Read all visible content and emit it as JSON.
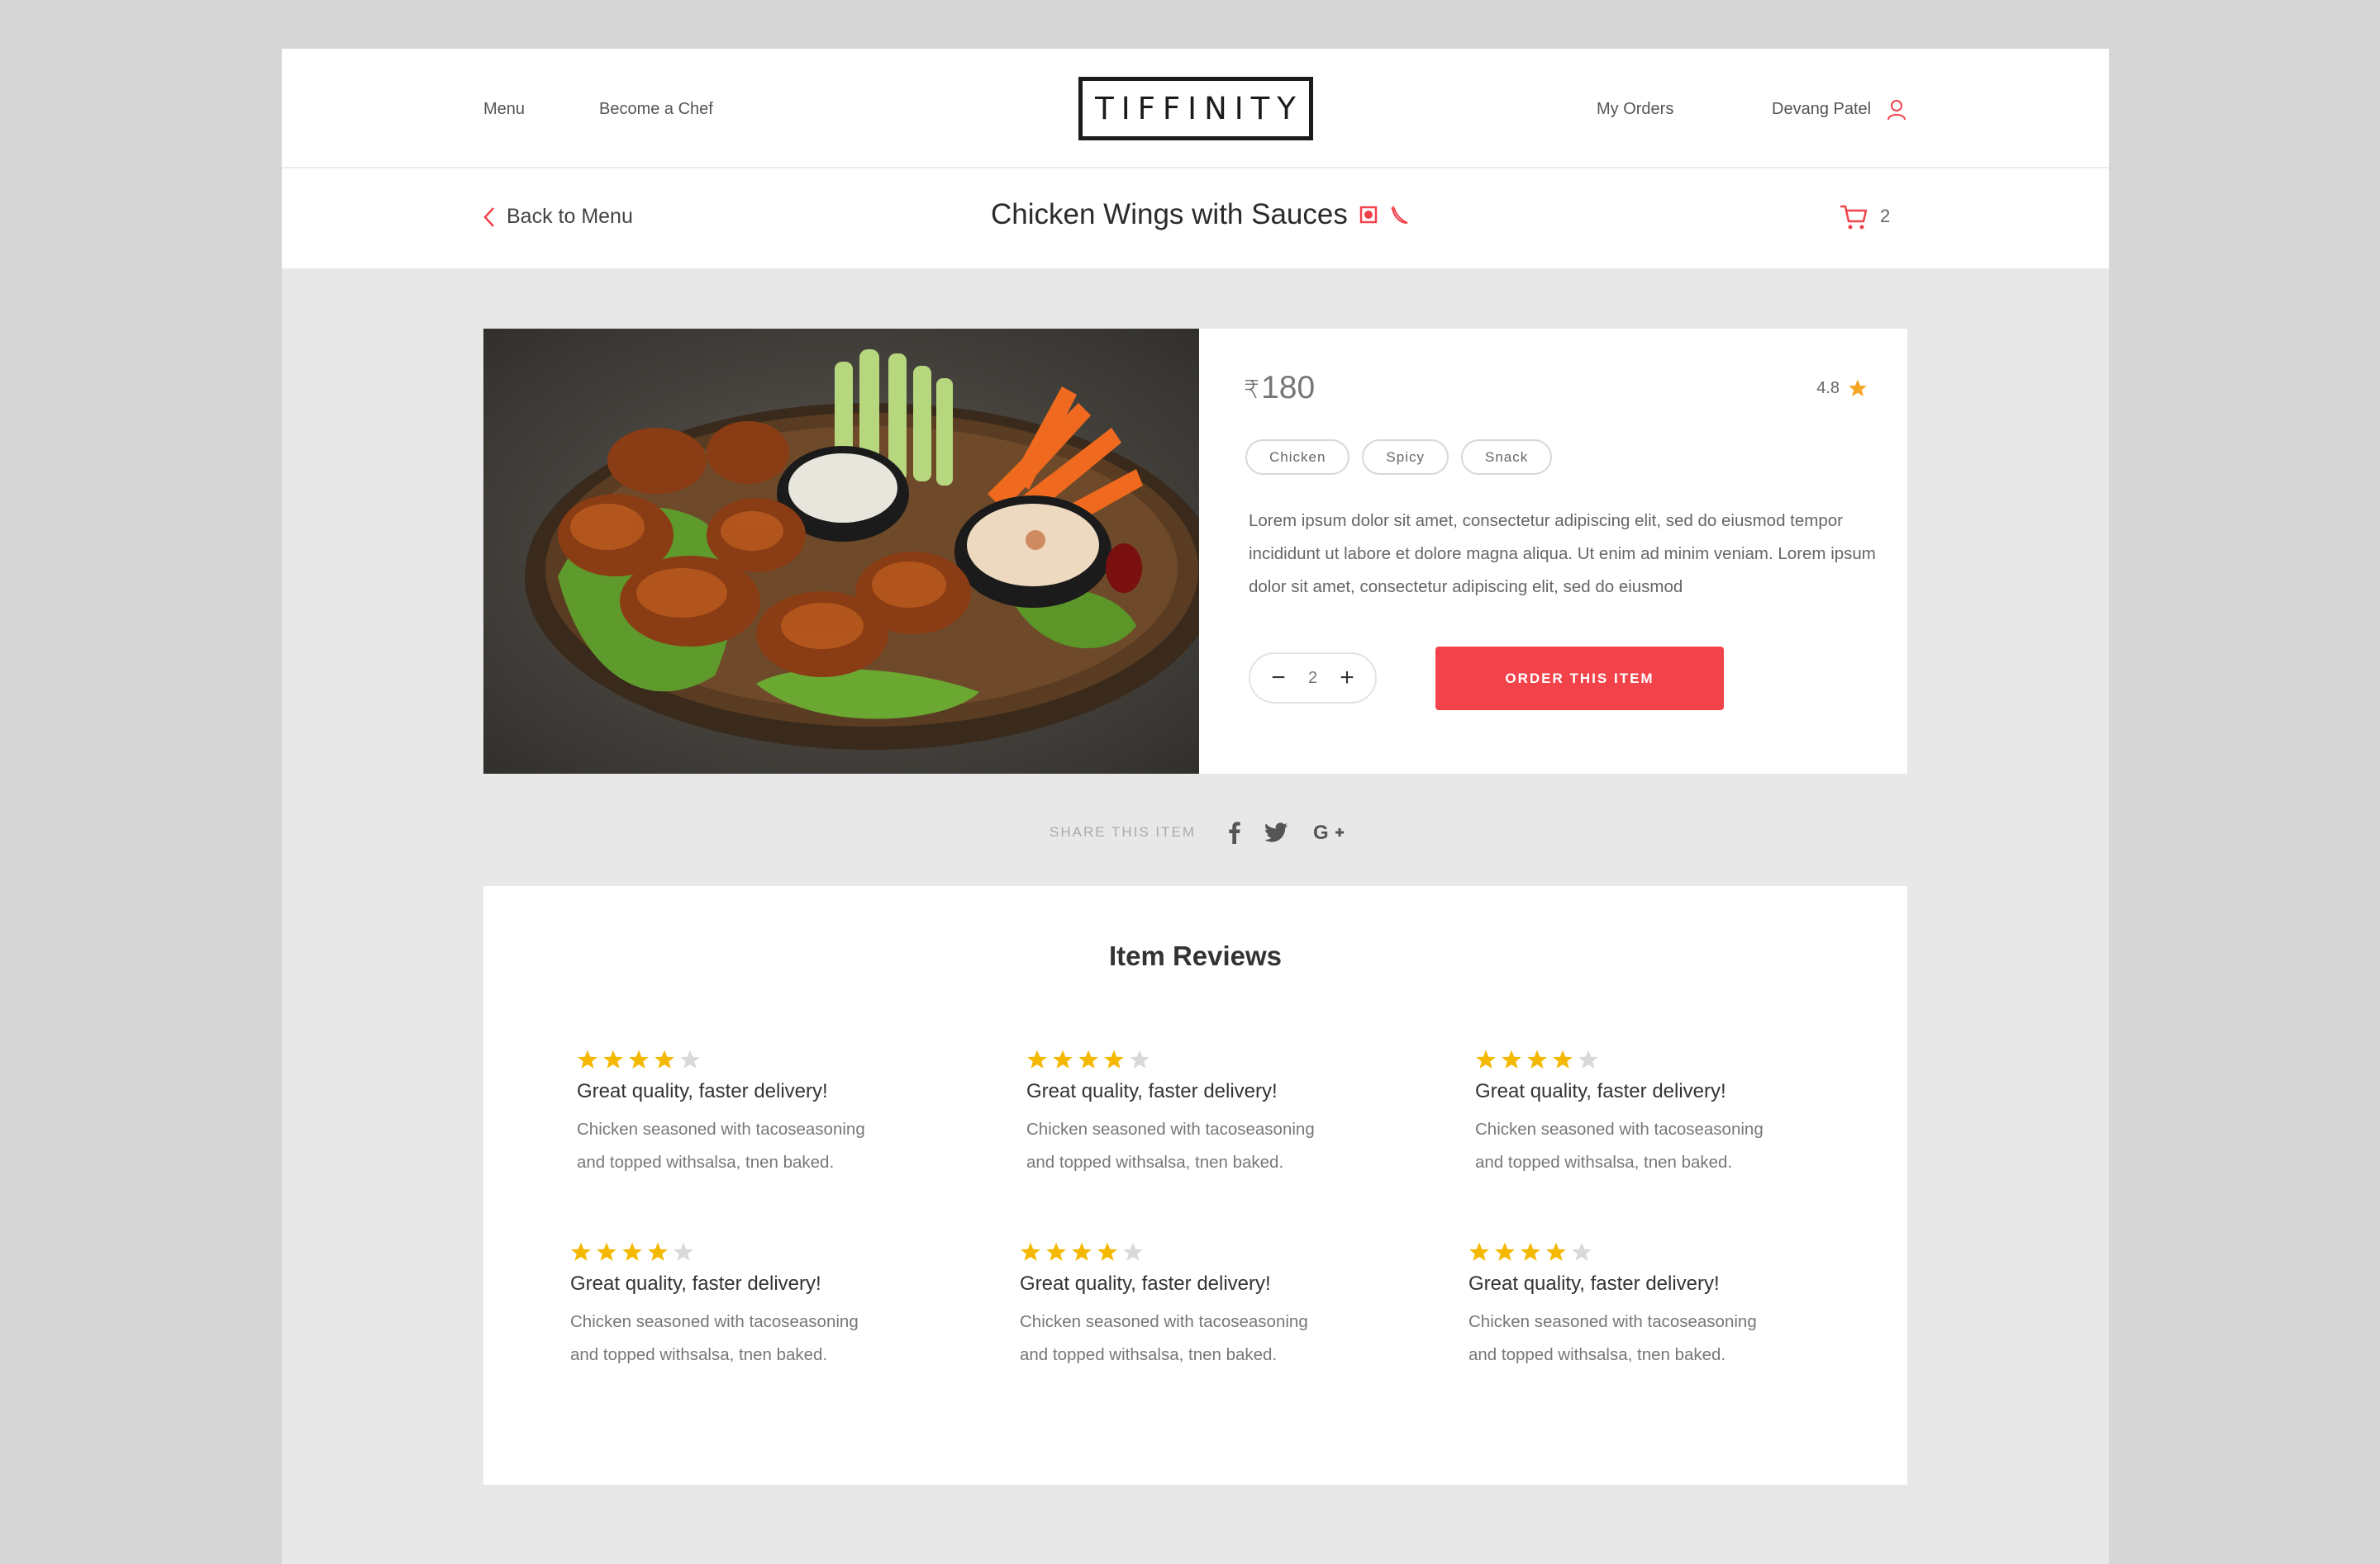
{
  "nav": {
    "menu_label": "Menu",
    "become_chef_label": "Become a Chef",
    "logo_text": "TIFFINITY",
    "my_orders_label": "My Orders",
    "user_name": "Devang Patel"
  },
  "subheader": {
    "back_label": "Back to Menu",
    "dish_title": "Chicken Wings with Sauces",
    "cart_count": "2"
  },
  "product": {
    "currency_symbol": "₹",
    "price": "180",
    "rating": "4.8",
    "tags": [
      "Chicken",
      "Spicy",
      "Snack"
    ],
    "description": "Lorem ipsum dolor sit amet, consectetur adipiscing elit, sed do eiusmod tempor incididunt ut labore et dolore magna aliqua. Ut enim ad minim veniam. Lorem ipsum dolor sit amet, consectetur adipiscing elit, sed do eiusmod",
    "quantity": "2",
    "order_button_label": "ORDER THIS ITEM"
  },
  "share": {
    "label": "SHARE THIS ITEM",
    "icons": [
      "facebook-icon",
      "twitter-icon",
      "google-plus-icon"
    ]
  },
  "reviews": {
    "title": "Item Reviews",
    "items": [
      {
        "rating": 4,
        "title": "Great quality, faster delivery!",
        "text_line1": "Chicken seasoned with tacoseasoning",
        "text_line2": "and topped withsalsa, tnen baked."
      },
      {
        "rating": 4,
        "title": "Great quality, faster delivery!",
        "text_line1": "Chicken seasoned with tacoseasoning",
        "text_line2": "and topped withsalsa, tnen baked."
      },
      {
        "rating": 4,
        "title": "Great quality, faster delivery!",
        "text_line1": "Chicken seasoned with tacoseasoning",
        "text_line2": "and topped withsalsa, tnen baked."
      },
      {
        "rating": 4,
        "title": "Great quality, faster delivery!",
        "text_line1": "Chicken seasoned with tacoseasoning",
        "text_line2": "and topped withsalsa, tnen baked."
      },
      {
        "rating": 4,
        "title": "Great quality, faster delivery!",
        "text_line1": "Chicken seasoned with tacoseasoning",
        "text_line2": "and topped withsalsa, tnen baked."
      },
      {
        "rating": 4,
        "title": "Great quality, faster delivery!",
        "text_line1": "Chicken seasoned with tacoseasoning",
        "text_line2": "and topped withsalsa, tnen baked."
      }
    ]
  },
  "colors": {
    "accent": "#f2424a",
    "star": "#f5b800",
    "star_empty": "#d9d9d9",
    "rating_star": "#f5a623",
    "page_bg": "#e8e8e8"
  }
}
